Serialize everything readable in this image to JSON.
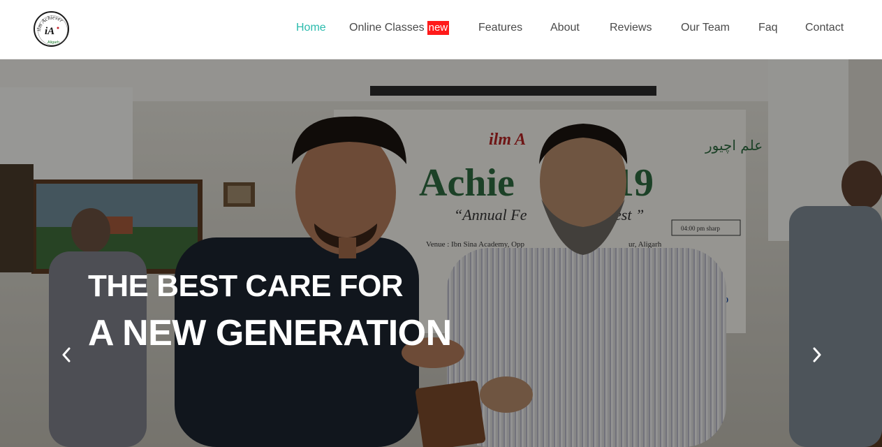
{
  "header": {
    "logo_text": "ilm Achiever",
    "logo_subtext": "Aligarh",
    "logo_monogram": "iA",
    "nav": [
      {
        "label": "Home",
        "active": true
      },
      {
        "label": "Online Classes",
        "badge": "new"
      },
      {
        "label": "Features"
      },
      {
        "label": "About"
      },
      {
        "label": "Reviews"
      },
      {
        "label": "Our Team"
      },
      {
        "label": "Faq"
      },
      {
        "label": "Contact"
      }
    ]
  },
  "hero": {
    "line1": "THE BEST CARE FOR",
    "line2": "A NEW GENERATION",
    "prev_icon": "chevron-left-icon",
    "next_icon": "chevron-right-icon"
  },
  "colors": {
    "accent": "#2bbbad",
    "badge": "#ff1a1a",
    "nav_text": "#4a4a4a"
  }
}
